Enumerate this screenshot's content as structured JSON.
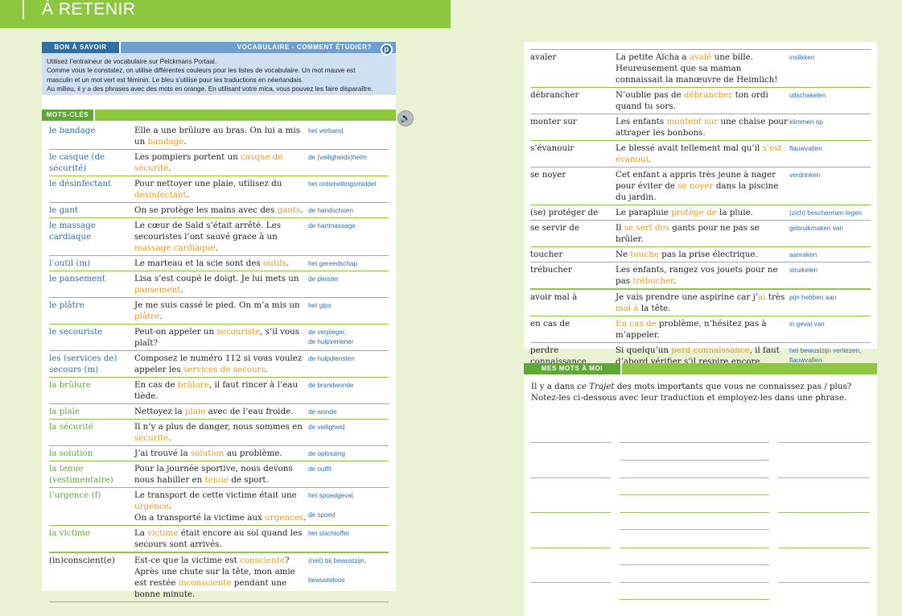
{
  "header": {
    "title": "À RETENIR"
  },
  "bon_a_savoir": {
    "tab_left": "BON À SAVOIR",
    "tab_right": "VOCABULAIRE - COMMENT ÉTUDIER?",
    "portal_icon": "p-icon",
    "lines": [
      "Utilisez l’entraineur de vocabulaire sur Pelckmans Portaal.",
      "Comme vous le constatez, on utilise différentes couleurs pour les listes de vocabulaire. Un mot mauve est",
      "masculin et un mot vert est féminin. Le bleu s’utilise pour les traductions en néerlandais.",
      "Au milieu, il y a des phrases avec des mots en orange. En utilisant votre mica, vous pouvez les faire disparaître."
    ]
  },
  "mots_cles": {
    "tab": "MOTS-CLÉS",
    "speaker_icon": "speaker-icon",
    "rows": [
      {
        "word": "le bandage",
        "pre": "Elle a une brûlure au bras. On lui a mis un ",
        "hl": "bandage",
        "post": ".",
        "trans": "het verband"
      },
      {
        "word": "le casque (de sécurité)",
        "pre": "Les pompiers portent un ",
        "hl": "casque de sécurité",
        "post": ".",
        "trans": "de (veiligheids)helm"
      },
      {
        "word": "le désinfectant",
        "pre": "Pour nettoyer une plaie, utilisez du ",
        "hl": "désinfectant",
        "post": ".",
        "trans": "het ontsmettingsmiddel"
      },
      {
        "word": "le gant",
        "pre": "On se protège les mains avec des ",
        "hl": "gants",
        "post": ".",
        "trans": "de handschoen"
      },
      {
        "word": "le massage cardiaque",
        "pre": "Le cœur de Saïd s’était arrêté. Les secouristes l’ont sauvé grace à un ",
        "hl": "massage cardiaque",
        "post": ".",
        "trans": "de hartmassage"
      },
      {
        "word": "l’outil (m)",
        "pre": "Le marteau et la scie sont des ",
        "hl": "outils",
        "post": ".",
        "trans": "het gereedschap"
      },
      {
        "word": "le pansement",
        "pre": "Lisa s’est coupé le doigt. Je lui mets un ",
        "hl": "pansement",
        "post": ".",
        "trans": "de pleister"
      },
      {
        "word": "le plâtre",
        "pre": "Je me suis cassé le pied. On m’a mis un ",
        "hl": "plâtre",
        "post": ".",
        "trans": "het gips"
      },
      {
        "word": "le secouriste",
        "pre": "Peut-on appeler un ",
        "hl": "secouriste",
        "post": ", s’il vous plaît?",
        "trans": "de verpleger,\nde hulpverlener"
      },
      {
        "word": "les (services de) secours (m)",
        "pre": "Composez le numéro 112 si vous voulez appeler les ",
        "hl": "services de secours",
        "post": ".",
        "trans": "de hulpdiensten"
      },
      {
        "word": "la brûlure",
        "pre": "En cas de ",
        "hl": "brûlure",
        "post": ", il faut rincer à l’eau tiède.",
        "trans": "de brandwonde"
      },
      {
        "word": "la plaie",
        "pre": "Nettoyez la ",
        "hl": "plaie",
        "post": " avec de l’eau froide.",
        "trans": "de wonde"
      },
      {
        "word": "la sécurité",
        "pre": "Il n’y a plus de danger, nous sommes en ",
        "hl": "sécurité",
        "post": ".",
        "trans": "de veiligheid"
      },
      {
        "word": "la solution",
        "pre": "J’ai trouvé la ",
        "hl": "solution",
        "post": " au problème.",
        "trans": "de oplossing"
      },
      {
        "word": "la tenue (vestimentaire)",
        "pre": "Pour la journée sportive, nous devons nous habiller en ",
        "hl": "tenue",
        "post": " de sport.",
        "trans": "de outfit"
      },
      {
        "word": "l’urgence (f)",
        "pre": "Le transport de cette victime était une ",
        "hl": "urgence",
        "post": ".",
        "pre2": "On a transporté la victime aux ",
        "hl2": "urgences",
        "post2": ".",
        "trans": "het spoedgeval,",
        "trans2": "de spoed"
      },
      {
        "word": "la victime",
        "pre": "La ",
        "hl": "victime",
        "post": " était encore au sol quand les secours sont arrivés.",
        "trans": "het slachtoffer"
      },
      {
        "word": "(in)conscient(e)",
        "pre": "Est-ce que la victime est ",
        "hl": "consciente",
        "post": "? Après une chute sur la tête, mon amie est restée ",
        "hl2": "inconsciente",
        "post2": " pendant une bonne minute.",
        "trans": "(niet) bij bewustzijn,",
        "trans2": "bewusteloos"
      }
    ]
  },
  "verbs": {
    "rows": [
      {
        "word": "avaler",
        "pre": "La petite Aïcha a ",
        "hl": "avalé",
        "post": " une bille. Heureusement que sa maman connaissait la manœuvre de Heimlich!",
        "trans": "inslikken"
      },
      {
        "word": "débrancher",
        "pre": "N’oublie pas de ",
        "hl": "débrancher",
        "post": " ton ordi quand tu sors.",
        "trans": "uitschakelen"
      },
      {
        "word": "monter sur",
        "pre": "Les enfants ",
        "hl": "montent sur",
        "post": " une chaise pour attraper les bonbons.",
        "trans": "klimmen op"
      },
      {
        "word": "s’évanouir",
        "pre": "Le blessé avait tellement mal qu’il ",
        "hl": "s’est évanoui",
        "post": ".",
        "trans": "flauwvallen"
      },
      {
        "word": "se noyer",
        "pre": "Cet enfant a appris très jeune à nager pour éviter de ",
        "hl": "se noyer",
        "post": " dans la piscine du jardin.",
        "trans": "verdrinken"
      },
      {
        "word": "(se) protéger de",
        "pre": "Le parapluie ",
        "hl": "protège de",
        "post": " la pluie.",
        "trans": "(zich) beschermen tegen"
      },
      {
        "word": "se servir de",
        "pre": "Il ",
        "hl": "se sert des",
        "post": " gants pour ne pas se brûler.",
        "trans": "gebruikmaken van"
      },
      {
        "word": "toucher",
        "pre": "Ne ",
        "hl": "touche",
        "post": " pas la prise électrique.",
        "trans": "aanraken"
      },
      {
        "word": "trébucher",
        "pre": "Les enfants, rangez vos jouets pour ne pas ",
        "hl": "trébucher",
        "post": ".",
        "trans": "struikelen"
      },
      {
        "word": "avoir mal à",
        "pre": "Je vais prendre une aspirine car j’",
        "hl": "ai",
        "post": " très ",
        "hl2": "mal à",
        "post2": " la tête.",
        "trans": "pijn hebben aan"
      },
      {
        "word": "en cas de",
        "pre": "",
        "hl": "En cas de",
        "post": " problème, n’hésitez pas à m’appeler.",
        "trans": "in geval van"
      },
      {
        "word": "perdre connaissance",
        "pre": "Si quelqu’un ",
        "hl": "perd connaissance",
        "post": ", il faut d’abord vérifier s’il respire encore.",
        "trans": "het bewustzijn verliezen, flauwvallen"
      }
    ]
  },
  "mes_mots": {
    "tab": "MES MOTS À MOI",
    "line1_pre": "Il y a dans ",
    "line1_italic": "ce Trajet",
    "line1_post": " des mots importants que vous ne connaissez pas / plus?",
    "line2": "Notez-les ci-dessous avec leur traduction et employez-les dans une phrase."
  }
}
